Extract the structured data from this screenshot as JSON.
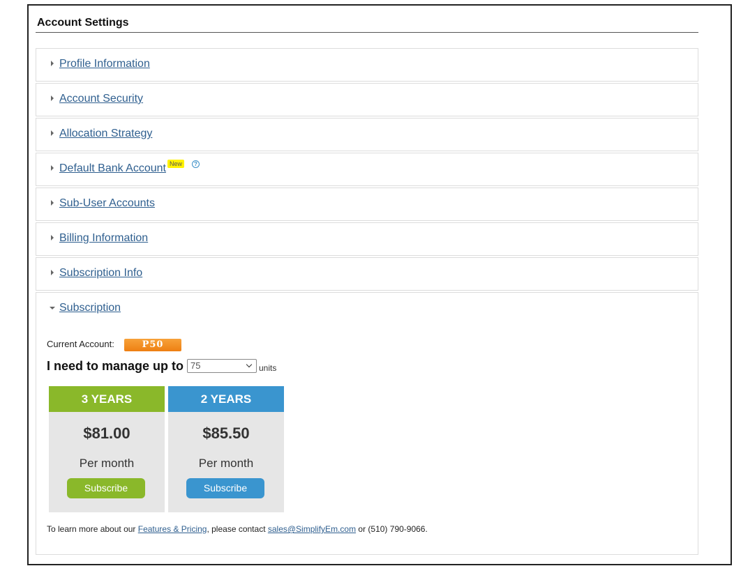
{
  "page": {
    "title": "Account Settings"
  },
  "sections": [
    {
      "label": "Profile Information"
    },
    {
      "label": "Account Security"
    },
    {
      "label": "Allocation Strategy"
    },
    {
      "label": "Default Bank Account",
      "badge": "New",
      "help": "?"
    },
    {
      "label": "Sub-User Accounts"
    },
    {
      "label": "Billing Information"
    },
    {
      "label": "Subscription Info"
    },
    {
      "label": "Subscription",
      "expanded": true
    }
  ],
  "subscription": {
    "current_label": "Current Account:",
    "current_plan": "P50",
    "manage_label": "I need to manage up to",
    "units_value": "75",
    "units_suffix": "units",
    "plans": [
      {
        "term": "3 YEARS",
        "price": "$81.00",
        "period": "Per month",
        "button": "Subscribe",
        "color": "#8ab82a"
      },
      {
        "term": "2 YEARS",
        "price": "$85.50",
        "period": "Per month",
        "button": "Subscribe",
        "color": "#3a95cf"
      }
    ],
    "footer": {
      "prefix": "To learn more about our ",
      "link1": "Features & Pricing",
      "middle": ", please contact ",
      "email": "sales@SimplifyEm.com",
      "suffix": " or (510) 790-9066."
    }
  },
  "colors": {
    "link": "#2f5f8f",
    "badge_orange": "#ee7f12",
    "new_badge": "#fff200"
  }
}
